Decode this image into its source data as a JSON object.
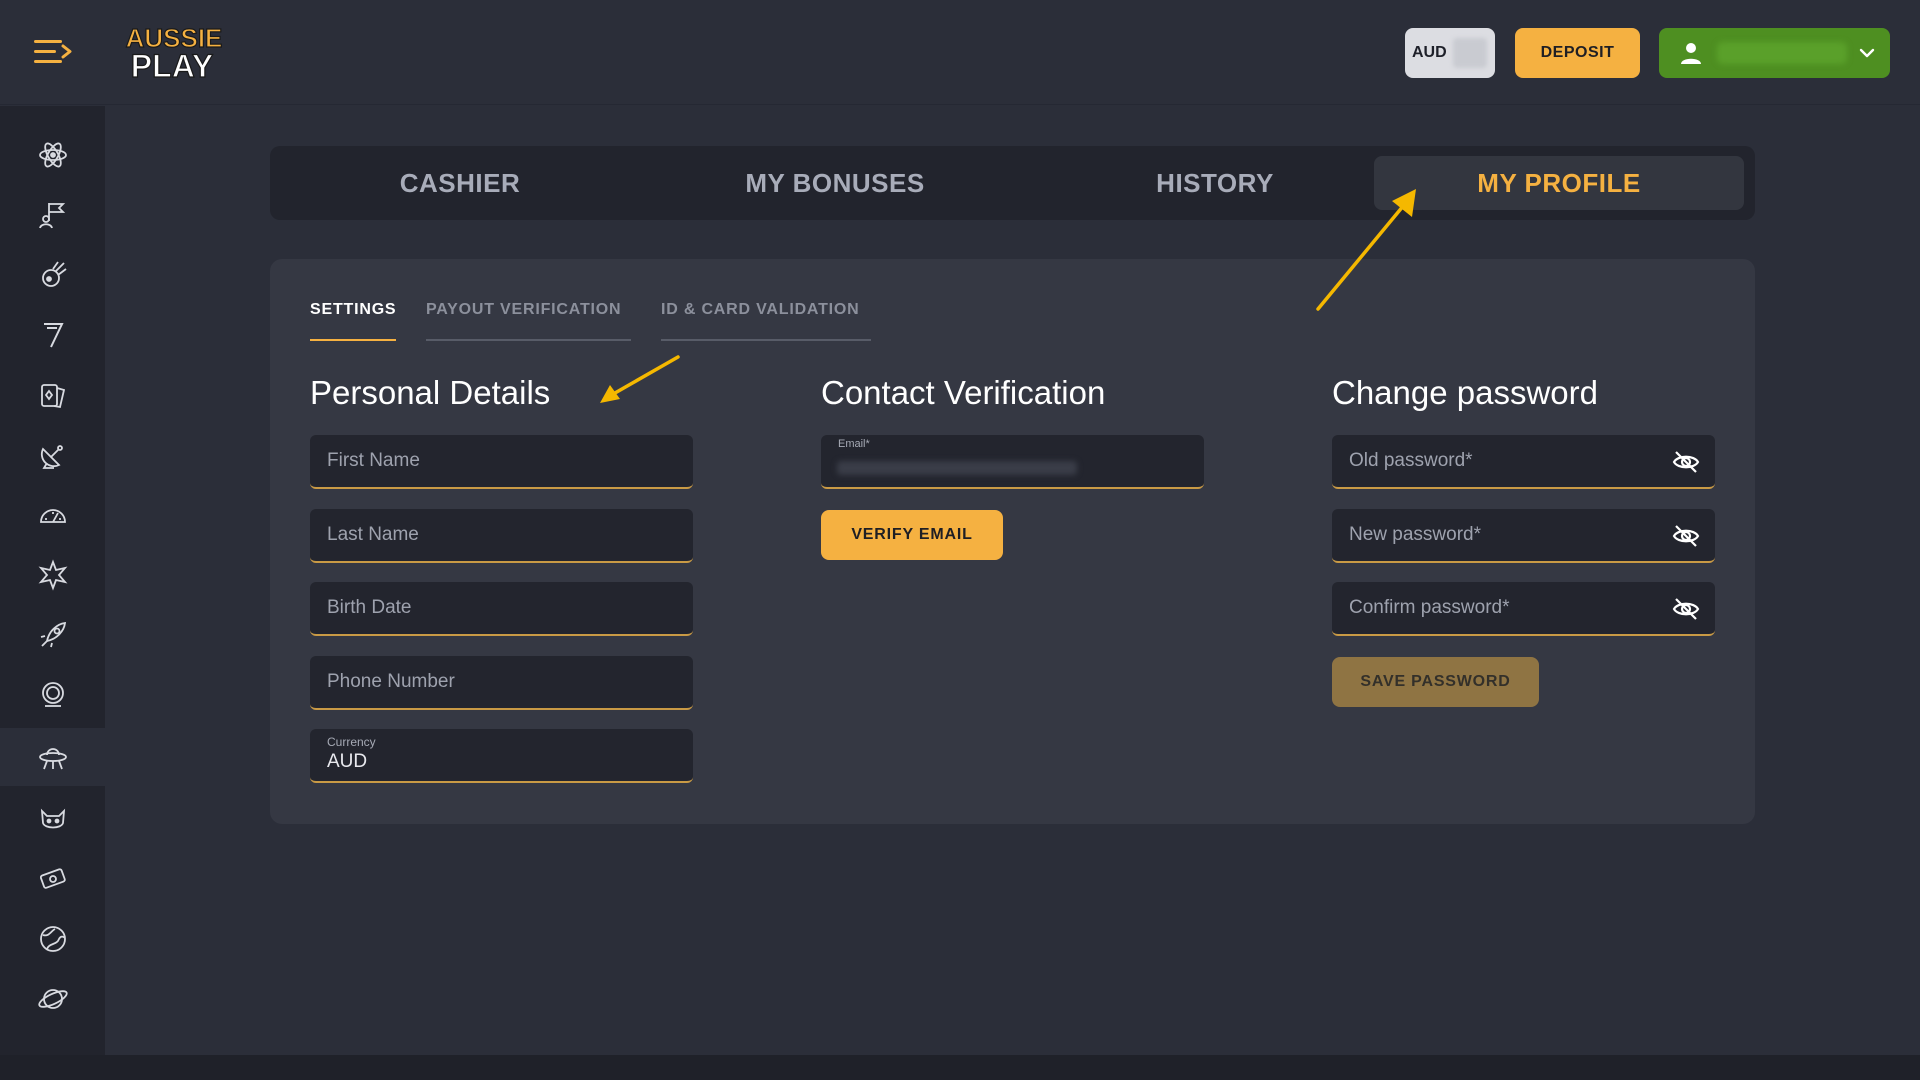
{
  "header": {
    "logo_line1": "AUSSIE",
    "logo_line2": "PLAY",
    "currency_button": "AUD",
    "deposit_button": "DEPOSIT"
  },
  "sidebar": {
    "items": [
      {
        "icon": "atom-icon"
      },
      {
        "icon": "astronaut-flag-icon"
      },
      {
        "icon": "meteor-icon"
      },
      {
        "icon": "lucky-seven-icon"
      },
      {
        "icon": "card-games-icon"
      },
      {
        "icon": "satellite-dish-icon"
      },
      {
        "icon": "speedometer-icon"
      },
      {
        "icon": "explosion-star-icon"
      },
      {
        "icon": "rocket-icon"
      },
      {
        "icon": "astronaut-helmet-icon"
      },
      {
        "icon": "ufo-icon"
      },
      {
        "icon": "alien-cat-icon"
      },
      {
        "icon": "money-icon"
      },
      {
        "icon": "globe-icon"
      },
      {
        "icon": "planet-icon"
      }
    ],
    "active_index": 10
  },
  "main_tabs": [
    "CASHIER",
    "MY BONUSES",
    "HISTORY",
    "MY PROFILE"
  ],
  "active_main_tab": "MY PROFILE",
  "sub_tabs": [
    "SETTINGS",
    "PAYOUT VERIFICATION",
    "ID & CARD VALIDATION"
  ],
  "active_sub_tab": "SETTINGS",
  "personal": {
    "title": "Personal Details",
    "first_name": "First Name",
    "last_name": "Last Name",
    "birth_date": "Birth Date",
    "phone": "Phone Number",
    "currency_label": "Currency",
    "currency_value": "AUD"
  },
  "contact": {
    "title": "Contact Verification",
    "email_label": "Email*",
    "verify_button": "VERIFY EMAIL"
  },
  "password": {
    "title": "Change password",
    "old": "Old password*",
    "new": "New password*",
    "confirm": "Confirm password*",
    "save_button": "SAVE PASSWORD"
  },
  "colors": {
    "accent": "#f5b141",
    "user_button": "#4e8f21",
    "background": "#2b2e39"
  }
}
